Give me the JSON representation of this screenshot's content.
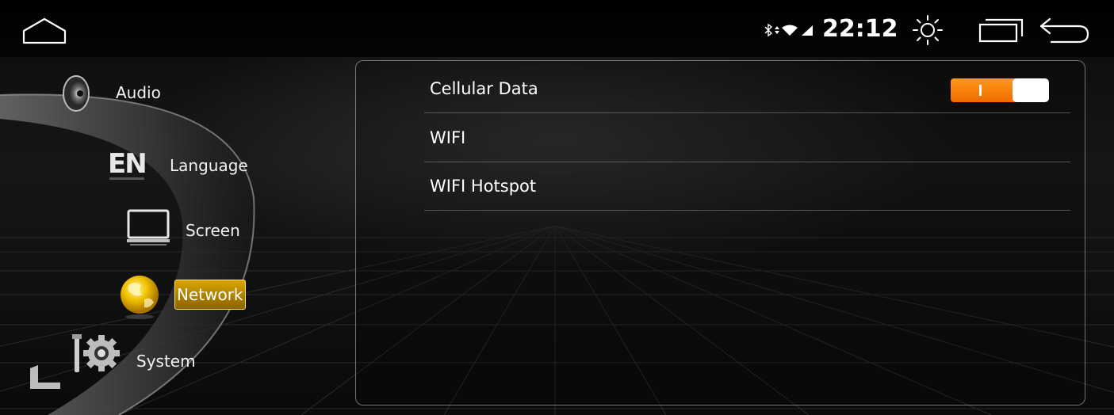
{
  "status_bar": {
    "time": "22:12",
    "icons": [
      "home-icon",
      "bluetooth-icon",
      "data-activity-icon",
      "wifi-icon",
      "signal-icon",
      "brightness-icon",
      "recent-apps-icon",
      "back-icon"
    ]
  },
  "menu": {
    "items": [
      {
        "label": "Audio",
        "icon": "speaker-icon",
        "selected": false
      },
      {
        "label": "Language",
        "icon": "language-en-icon",
        "selected": false
      },
      {
        "label": "Screen",
        "icon": "monitor-icon",
        "selected": false
      },
      {
        "label": "Network",
        "icon": "globe-icon",
        "selected": true
      },
      {
        "label": "System",
        "icon": "system-gear-icon",
        "selected": false
      }
    ]
  },
  "panel": {
    "rows": [
      {
        "label": "Cellular Data",
        "toggle_on": true
      },
      {
        "label": "WIFI"
      },
      {
        "label": "WIFI Hotspot"
      }
    ]
  },
  "colors": {
    "toggle_on": "#ff8a00",
    "selected_highlight": "#d9a400",
    "background": "#0d0d0d",
    "text": "#ffffff"
  }
}
